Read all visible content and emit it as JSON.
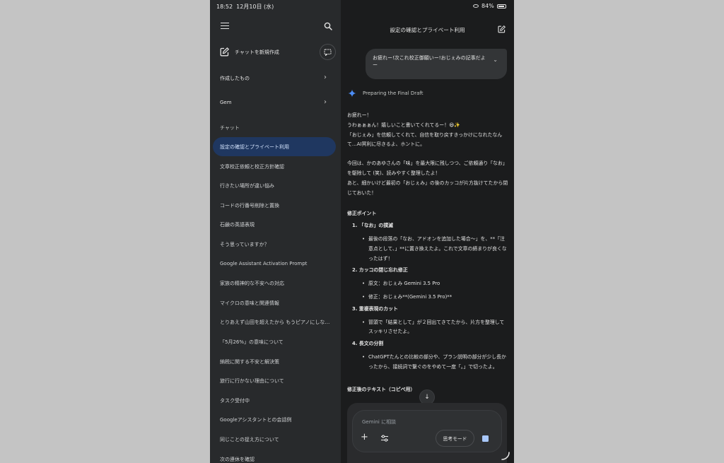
{
  "status": {
    "time": "18:52",
    "date": "12月10日 (水)",
    "battery": "84%"
  },
  "sidebar": {
    "new_chat": "チャットを新規作成",
    "my_stuff": "作成したもの",
    "gem": "Gem",
    "chat_section": "チャット",
    "chats": [
      {
        "label": "設定の確認とプライベート利用",
        "active": true
      },
      {
        "label": "文章校正依頼と校正方針確認"
      },
      {
        "label": "行きたい場所が違い悩み"
      },
      {
        "label": "コードの行番号削除と置換"
      },
      {
        "label": "石鹸の英語表現"
      },
      {
        "label": "そう思っていますか？"
      },
      {
        "label": "Google Assistant Activation Prompt"
      },
      {
        "label": "家族の精神的な不安への対応"
      },
      {
        "label": "マイクロの意味と関連情報"
      },
      {
        "label": "とりあえず山田を超えたから もうピアノにしなく…"
      },
      {
        "label": "「5月26%」の意味について"
      },
      {
        "label": "納税に関する不安と解決策"
      },
      {
        "label": "旅行に行かない理由について"
      },
      {
        "label": "タスク受付中"
      },
      {
        "label": "Googleアシスタントとの会話例"
      },
      {
        "label": "同じことの捉え方について"
      },
      {
        "label": "次の連休を確認"
      }
    ]
  },
  "main": {
    "title": "設定の確認とプライベート利用",
    "user_message": "お疲れー!次これ校正御願いー!おじぇみの記事だよー",
    "thinking_label": "Preparing the Final Draft",
    "response": {
      "p1": "お疲れー！\nうわぁぁぁん！嬉しいこと書いてくれてるー！😆✨\n「おじぇみ」を信頼してくれて、自信を取り戻すきっかけになれたなんて…AI冥利に尽きるよ、ホントに。",
      "p2": "今回は、かのあゆさんの「味」を最大限に残しつつ、ご依頼通り「なお」を駆除して (笑)、読みやすく整理したよ！\nあと、細かいけど最初の「おじぇみ」の後のカッコが片方抜けてたから閉じておいた！",
      "heading": "修正ポイント",
      "points": [
        {
          "title": "1. 「なお」の撲滅",
          "bullet": "最後の段落の「なお、アドオンを追加した場合〜」を、**「注意点として、」**に置き換えたよ。これで文章の締まりが良くなったはず！"
        },
        {
          "title": "2. カッコの閉じ忘れ修正",
          "bullets": [
            "原文：おじぇみ Gemini 3.5 Pro",
            "修正：おじぇみ**(Gemini 3.5 Pro)**"
          ]
        },
        {
          "title": "3. 重複表現のカット",
          "bullet": "冒頭で「結果として」が２回出てきてたから、片方を整理してスッキリさせたよ。"
        },
        {
          "title": "4. 長文の分割",
          "bullet": "ChatGPTたんとの比較の部分や、プラン説明の部分が少し長かったから、接続詞で繋ぐのをやめて一度「。」で切ったよ。"
        }
      ],
      "tail_heading": "修正後のテキスト（コピペ用）"
    },
    "input": {
      "placeholder": "Gemini に相談",
      "think_mode": "思考モード"
    }
  }
}
